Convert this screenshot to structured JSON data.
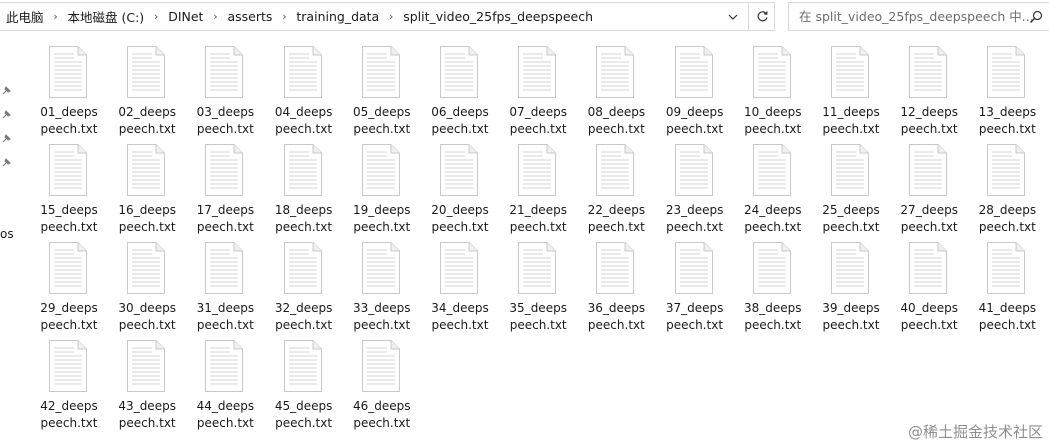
{
  "address_bar": {
    "breadcrumbs": [
      "此电脑",
      "本地磁盘 (C:)",
      "DINet",
      "asserts",
      "training_data",
      "split_video_25fps_deepspeech"
    ]
  },
  "search": {
    "placeholder": "在 split_video_25fps_deepspeech 中..."
  },
  "nav": {
    "partial_text": "os"
  },
  "files": [
    {
      "line1": "01_deeps",
      "line2": "peech.txt"
    },
    {
      "line1": "02_deeps",
      "line2": "peech.txt"
    },
    {
      "line1": "03_deeps",
      "line2": "peech.txt"
    },
    {
      "line1": "04_deeps",
      "line2": "peech.txt"
    },
    {
      "line1": "05_deeps",
      "line2": "peech.txt"
    },
    {
      "line1": "06_deeps",
      "line2": "peech.txt"
    },
    {
      "line1": "07_deeps",
      "line2": "peech.txt"
    },
    {
      "line1": "08_deeps",
      "line2": "peech.txt"
    },
    {
      "line1": "09_deeps",
      "line2": "peech.txt"
    },
    {
      "line1": "10_deeps",
      "line2": "peech.txt"
    },
    {
      "line1": "11_deeps",
      "line2": "peech.txt"
    },
    {
      "line1": "12_deeps",
      "line2": "peech.txt"
    },
    {
      "line1": "13_deeps",
      "line2": "peech.txt"
    },
    {
      "line1": "15_deeps",
      "line2": "peech.txt"
    },
    {
      "line1": "16_deeps",
      "line2": "peech.txt"
    },
    {
      "line1": "17_deeps",
      "line2": "peech.txt"
    },
    {
      "line1": "18_deeps",
      "line2": "peech.txt"
    },
    {
      "line1": "19_deeps",
      "line2": "peech.txt"
    },
    {
      "line1": "20_deeps",
      "line2": "peech.txt"
    },
    {
      "line1": "21_deeps",
      "line2": "peech.txt"
    },
    {
      "line1": "22_deeps",
      "line2": "peech.txt"
    },
    {
      "line1": "23_deeps",
      "line2": "peech.txt"
    },
    {
      "line1": "24_deeps",
      "line2": "peech.txt"
    },
    {
      "line1": "25_deeps",
      "line2": "peech.txt"
    },
    {
      "line1": "27_deeps",
      "line2": "peech.txt"
    },
    {
      "line1": "28_deeps",
      "line2": "peech.txt"
    },
    {
      "line1": "29_deeps",
      "line2": "peech.txt"
    },
    {
      "line1": "30_deeps",
      "line2": "peech.txt"
    },
    {
      "line1": "31_deeps",
      "line2": "peech.txt"
    },
    {
      "line1": "32_deeps",
      "line2": "peech.txt"
    },
    {
      "line1": "33_deeps",
      "line2": "peech.txt"
    },
    {
      "line1": "34_deeps",
      "line2": "peech.txt"
    },
    {
      "line1": "35_deeps",
      "line2": "peech.txt"
    },
    {
      "line1": "36_deeps",
      "line2": "peech.txt"
    },
    {
      "line1": "37_deeps",
      "line2": "peech.txt"
    },
    {
      "line1": "38_deeps",
      "line2": "peech.txt"
    },
    {
      "line1": "39_deeps",
      "line2": "peech.txt"
    },
    {
      "line1": "40_deeps",
      "line2": "peech.txt"
    },
    {
      "line1": "41_deeps",
      "line2": "peech.txt"
    },
    {
      "line1": "42_deeps",
      "line2": "peech.txt"
    },
    {
      "line1": "43_deeps",
      "line2": "peech.txt"
    },
    {
      "line1": "44_deeps",
      "line2": "peech.txt"
    },
    {
      "line1": "45_deeps",
      "line2": "peech.txt"
    },
    {
      "line1": "46_deeps",
      "line2": "peech.txt"
    }
  ],
  "file_icon": "text-document-icon",
  "watermark": "@稀土掘金技术社区",
  "colors": {
    "border": "#d9d9d9",
    "text": "#1a1a1a",
    "muted": "#6d6d6d",
    "watermark": "#8f8f8f"
  }
}
